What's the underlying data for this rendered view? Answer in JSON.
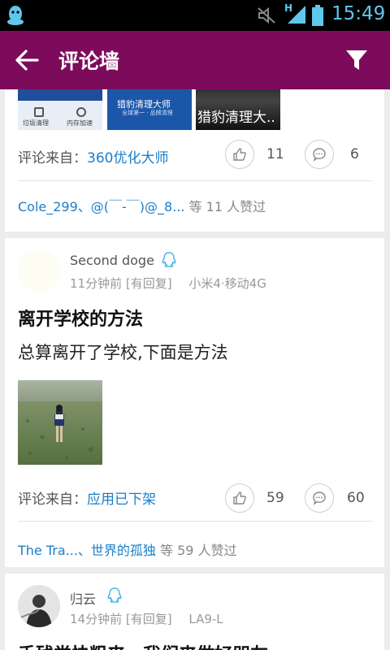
{
  "status_bar": {
    "time": "15:49",
    "network": "H",
    "icons": [
      "qq-icon",
      "mute-icon",
      "signal-icon",
      "battery-icon"
    ],
    "accent": "#5fc7ec"
  },
  "app_bar": {
    "title": "评论墙",
    "back_icon": "arrow-left-icon",
    "filter_icon": "filter-icon",
    "color": "#7d0b5c"
  },
  "posts": [
    {
      "thumbnails": [
        {
          "labels": [
            "垃圾清理",
            "内存加速"
          ]
        },
        {
          "caption": "猎豹清理大师",
          "subcaption": "全球第一 · 品牌清理"
        },
        {
          "caption": "猎豹清理大.."
        }
      ],
      "source_label": "评论来自：",
      "source_app": "360优化大师",
      "likes": "11",
      "comments": "6",
      "liked_by_names": "Cole_299、@(￣-￣)@_8...",
      "liked_by_suffix": "等 11 人赞过"
    },
    {
      "username": "Second doge",
      "time": "11分钟前",
      "reply_tag": "[有回复]",
      "device": "小米4·移动4G",
      "title": "离开学校的方法",
      "body": "总算离开了学校,下面是方法",
      "source_label": "评论来自：",
      "source_app": "应用已下架",
      "likes": "59",
      "comments": "60",
      "liked_by_names": "The  Tra...、世界的孤独",
      "liked_by_suffix": "等 59 人赞过"
    },
    {
      "username": "归云",
      "time": "14分钟前",
      "reply_tag": "[有回复]",
      "device": "LA9-L",
      "title": "手残党快粗来，我们来做好朋友"
    }
  ],
  "colors": {
    "link": "#1a7ec8",
    "muted": "#999999",
    "background": "#ececec"
  }
}
